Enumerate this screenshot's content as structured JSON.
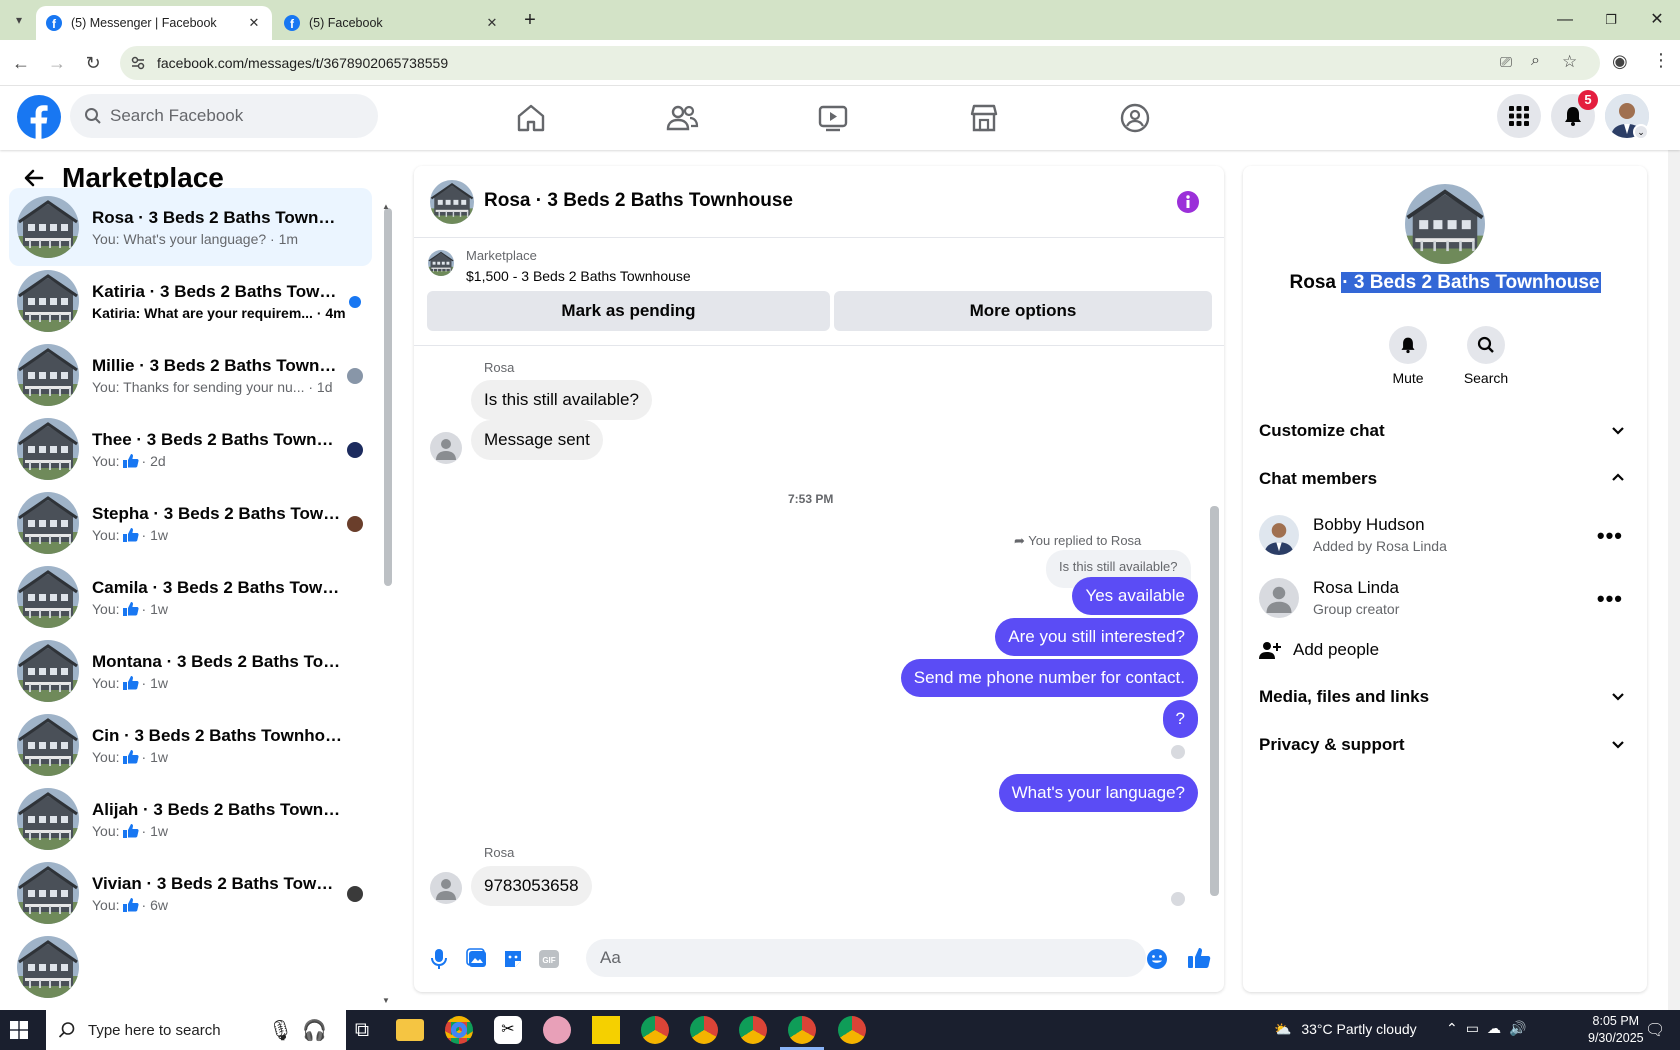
{
  "browser": {
    "tabs": [
      {
        "title": "(5) Messenger | Facebook",
        "active": true
      },
      {
        "title": "(5) Facebook",
        "active": false
      }
    ],
    "url": "facebook.com/messages/t/3678902065738559"
  },
  "fb_header": {
    "search_placeholder": "Search Facebook",
    "notification_count": "5"
  },
  "sidebar": {
    "title": "Marketplace",
    "conversations": [
      {
        "name": "Rosa · 3 Beds 2 Baths Townhouse",
        "preview": "You: What's your language? · 1m",
        "selected": true
      },
      {
        "name": "Katiria · 3 Beds 2 Baths Townh...",
        "preview": "Katiria: What are your requirem... · 4m",
        "unread": true
      },
      {
        "name": "Millie · 3 Beds 2 Baths Townho...",
        "preview": "You: Thanks for sending your nu... · 1d"
      },
      {
        "name": "Thee · 3 Beds 2 Baths Townho...",
        "preview_prefix": "You:",
        "preview_suffix": "· 2d"
      },
      {
        "name": "Stepha · 3 Beds 2 Baths Town...",
        "preview_prefix": "You:",
        "preview_suffix": "· 1w"
      },
      {
        "name": "Camila · 3 Beds 2 Baths Townho...",
        "preview_prefix": "You:",
        "preview_suffix": "· 1w"
      },
      {
        "name": "Montana · 3 Beds 2 Baths Townh...",
        "preview_prefix": "You:",
        "preview_suffix": "· 1w"
      },
      {
        "name": "Cin · 3 Beds 2 Baths Townhouse",
        "preview_prefix": "You:",
        "preview_suffix": "· 1w"
      },
      {
        "name": "Alijah · 3 Beds 2 Baths Townhouse",
        "preview_prefix": "You:",
        "preview_suffix": "· 1w"
      },
      {
        "name": "Vivian · 3 Beds 2 Baths Townh...",
        "preview_prefix": "You:",
        "preview_suffix": "· 6w"
      }
    ]
  },
  "chat": {
    "title": "Rosa · 3 Beds 2 Baths Townhouse",
    "marketplace_label": "Marketplace",
    "listing": "$1,500 - 3 Beds 2 Baths Townhouse",
    "mark_pending": "Mark as pending",
    "more_options": "More options",
    "sender_rosa": "Rosa",
    "msg1": "Is this still available?",
    "msg2": "Message sent",
    "time": "7:53 PM",
    "replied_label": "You replied to Rosa",
    "quoted": "Is this still available?",
    "out1": "Yes available",
    "out2": "Are you still interested?",
    "out3": "Send me phone number for contact.",
    "out4": "?",
    "out5": "What's your language?",
    "sender_rosa2": "Rosa",
    "msg3": "9783053658",
    "composer_placeholder": "Aa"
  },
  "info_panel": {
    "title_plain": "Rosa",
    "title_selected": "· 3 Beds 2 Baths Townhouse",
    "mute": "Mute",
    "search": "Search",
    "customize": "Customize chat",
    "members_label": "Chat members",
    "members": [
      {
        "name": "Bobby Hudson",
        "sub": "Added by Rosa Linda"
      },
      {
        "name": "Rosa Linda",
        "sub": "Group creator"
      }
    ],
    "add_people": "Add people",
    "media": "Media, files and links",
    "privacy": "Privacy & support"
  },
  "taskbar": {
    "search_placeholder": "Type here to search",
    "weather": "33°C  Partly cloudy",
    "time": "8:05 PM",
    "date": "9/30/2025"
  },
  "colors": {
    "fb_blue": "#1877f2",
    "outgoing": "#5b4cf5",
    "selected_bg": "#ebf5ff",
    "notification": "#e41e3f",
    "info_icon": "#9b30d9"
  }
}
